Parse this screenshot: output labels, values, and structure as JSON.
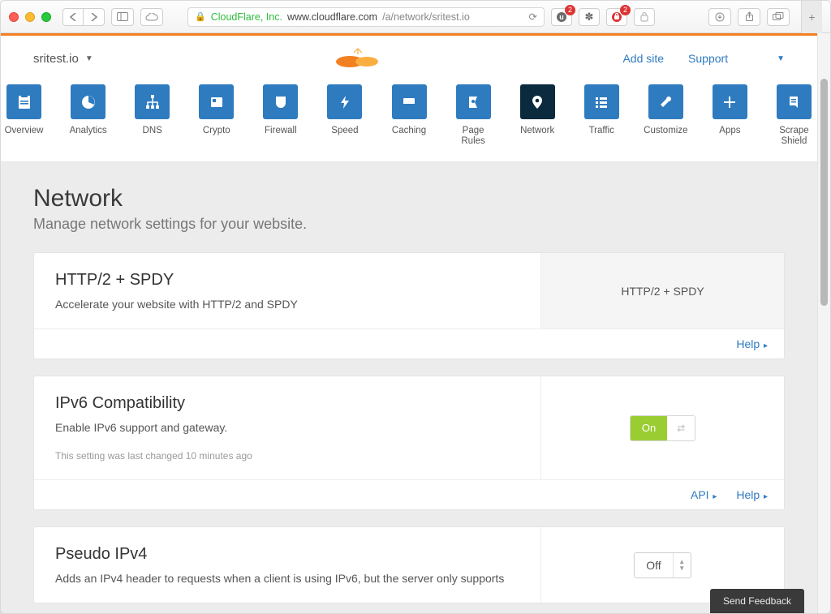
{
  "browser": {
    "issuer": "CloudFlare, Inc.",
    "host": "www.cloudflare.com",
    "path": "/a/network/sritest.io",
    "ext_badge_u": "2",
    "ext_badge_lp": "2"
  },
  "header": {
    "site": "sritest.io",
    "add_site": "Add site",
    "support": "Support"
  },
  "nav": [
    {
      "label": "Overview"
    },
    {
      "label": "Analytics"
    },
    {
      "label": "DNS"
    },
    {
      "label": "Crypto"
    },
    {
      "label": "Firewall"
    },
    {
      "label": "Speed"
    },
    {
      "label": "Caching"
    },
    {
      "label": "Page Rules"
    },
    {
      "label": "Network"
    },
    {
      "label": "Traffic"
    },
    {
      "label": "Customize"
    },
    {
      "label": "Apps"
    },
    {
      "label": "Scrape Shield"
    }
  ],
  "page": {
    "title": "Network",
    "subtitle": "Manage network settings for your website."
  },
  "cards": {
    "http2": {
      "title": "HTTP/2 + SPDY",
      "desc": "Accelerate your website with HTTP/2 and SPDY",
      "status": "HTTP/2 + SPDY",
      "help": "Help"
    },
    "ipv6": {
      "title": "IPv6 Compatibility",
      "desc": "Enable IPv6 support and gateway.",
      "meta": "This setting was last changed 10 minutes ago",
      "toggle": "On",
      "api": "API",
      "help": "Help"
    },
    "pipv4": {
      "title": "Pseudo IPv4",
      "desc": "Adds an IPv4 header to requests when a client is using IPv6, but the server only supports",
      "select": "Off"
    }
  },
  "feedback": "Send Feedback"
}
